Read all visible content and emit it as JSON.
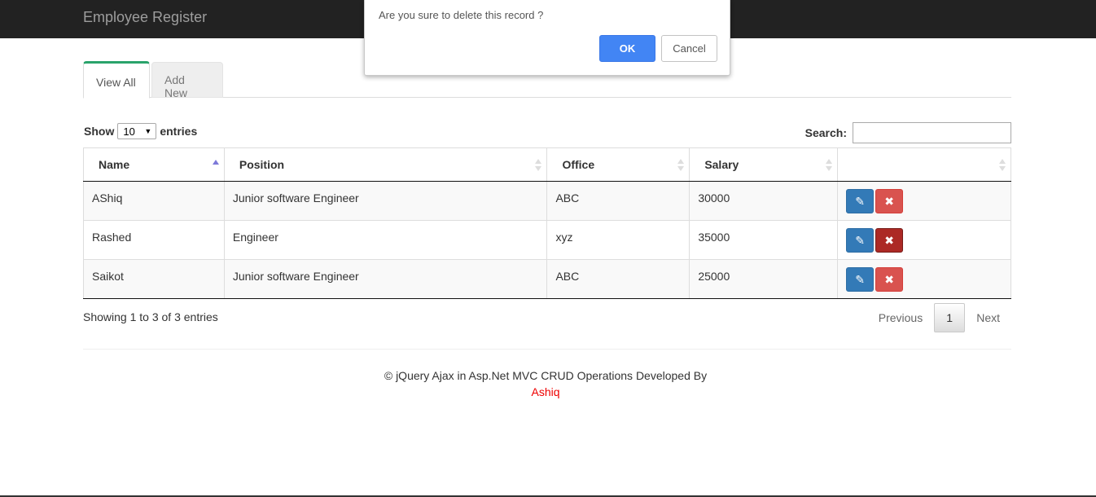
{
  "navbar": {
    "brand": "Employee Register"
  },
  "tabs": [
    {
      "label": "View All",
      "active": true
    },
    {
      "label": "Add New",
      "active": false
    }
  ],
  "table_controls": {
    "show_label": "Show",
    "page_size": "10",
    "entries_label": "entries",
    "search_label": "Search:",
    "search_value": ""
  },
  "table": {
    "columns": [
      "Name",
      "Position",
      "Office",
      "Salary",
      ""
    ],
    "sorted_column": "Name",
    "rows": [
      {
        "name": "AShiq",
        "position": "Junior software Engineer",
        "office": "ABC",
        "salary": "30000"
      },
      {
        "name": "Rashed",
        "position": "Engineer",
        "office": "xyz",
        "salary": "35000"
      },
      {
        "name": "Saikot",
        "position": "Junior software Engineer",
        "office": "ABC",
        "salary": "25000"
      }
    ]
  },
  "pagination": {
    "info": "Showing 1 to 3 of 3 entries",
    "previous": "Previous",
    "current": "1",
    "next": "Next"
  },
  "footer": {
    "text": "© jQuery Ajax in Asp.Net MVC CRUD Operations Developed By",
    "author": "Ashiq"
  },
  "dialog": {
    "message": "Are you sure to delete this record ?",
    "ok": "OK",
    "cancel": "Cancel"
  },
  "icons": {
    "edit": "pencil-icon",
    "delete": "times-icon"
  },
  "colors": {
    "accent_tab": "#2aa36b",
    "edit_button": "#337ab7",
    "delete_button": "#d9534f",
    "ok_button": "#4285f4",
    "author_link": "#ee0000"
  }
}
